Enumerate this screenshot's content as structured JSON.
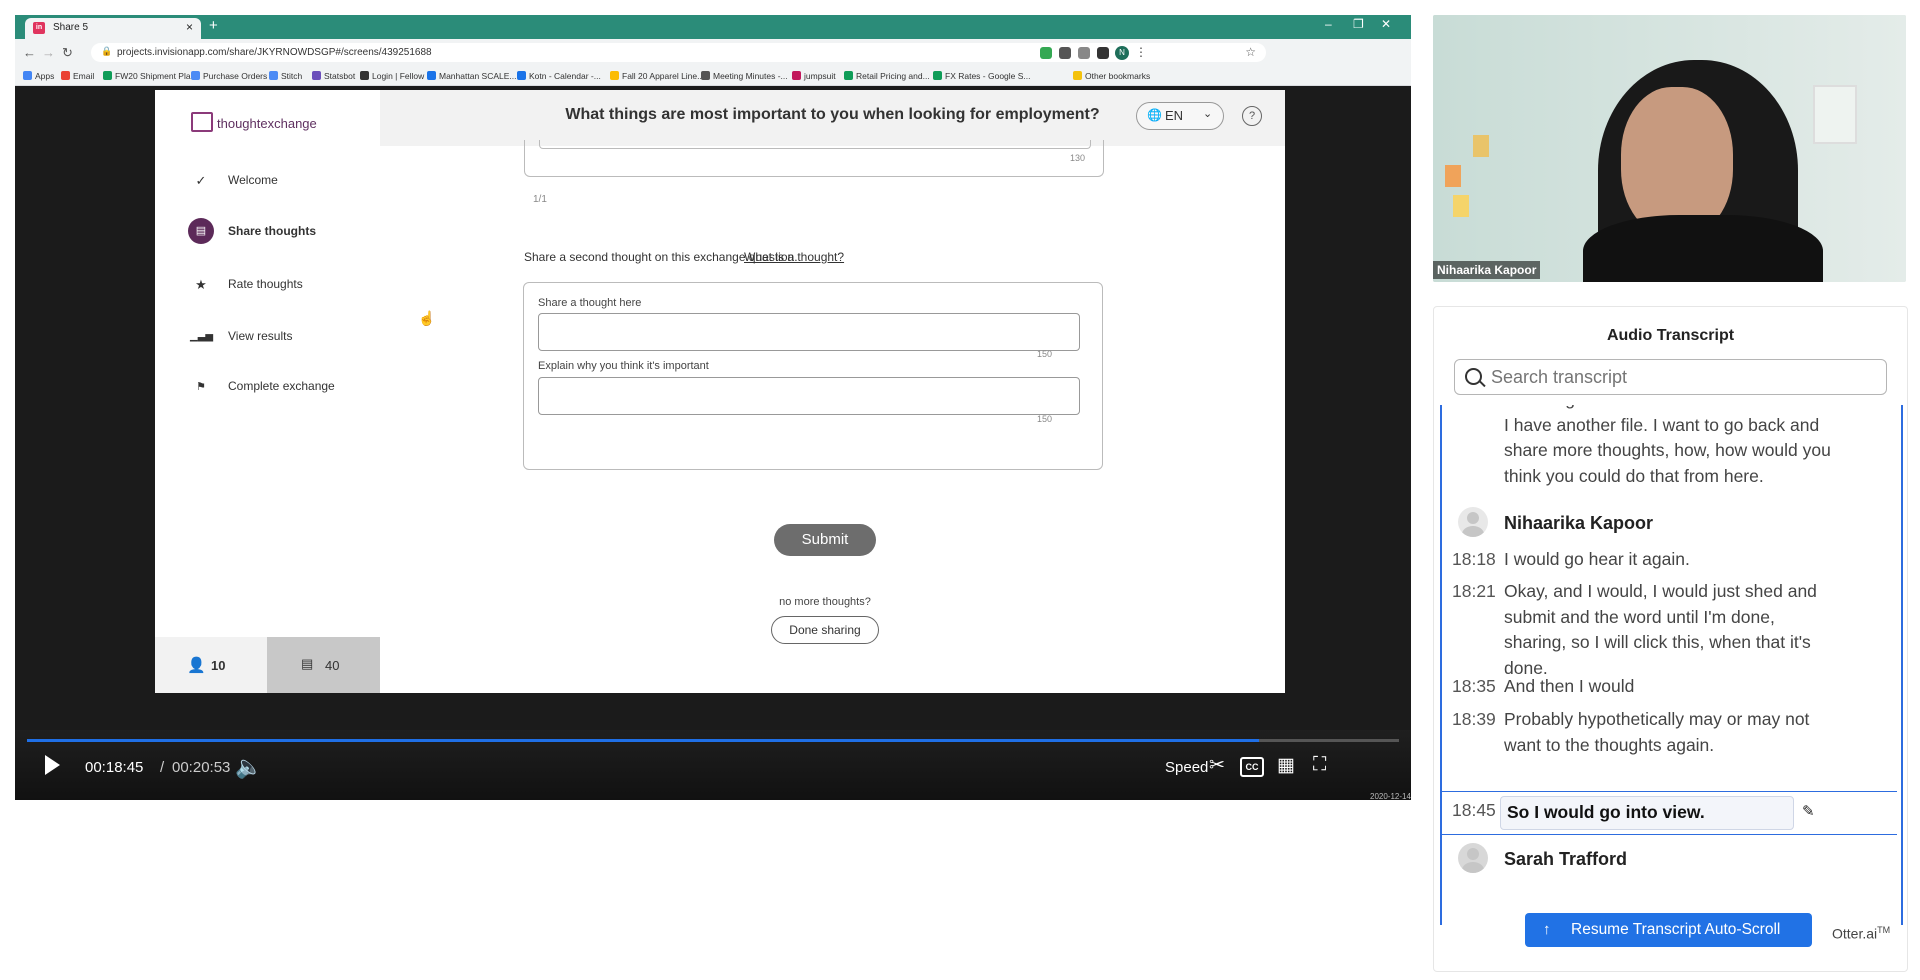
{
  "browser": {
    "tab_title": "Share 5",
    "url": "projects.invisionapp.com/share/JKYRNOWDSGP#/screens/439251688",
    "bookmarks": [
      "Apps",
      "Email",
      "FW20 Shipment Pla...",
      "Purchase Orders",
      "Stitch",
      "Statsbot",
      "Login | Fellow",
      "Manhattan SCALE...",
      "Kotn - Calendar -...",
      "Fall 20 Apparel Line...",
      "Meeting Minutes -...",
      "jumpsuit",
      "Retail Pricing and...",
      "FX Rates - Google S...",
      "Other bookmarks"
    ],
    "profile_initial": "N",
    "icons": [
      "back-arrow",
      "forward-arrow",
      "refresh",
      "lock",
      "star",
      "puzzle",
      "menu-dots"
    ]
  },
  "app": {
    "logo_text": "thoughtexchange",
    "question": "What things are most important to you when looking for employment?",
    "language": "EN",
    "help": "?",
    "steps": [
      {
        "label": "Welcome",
        "icon": "check"
      },
      {
        "label": "Share thoughts",
        "icon": "share"
      },
      {
        "label": "Rate thoughts",
        "icon": "star"
      },
      {
        "label": "View results",
        "icon": "bars"
      },
      {
        "label": "Complete exchange",
        "icon": "flag"
      }
    ],
    "participants_count": "10",
    "thoughts_count": "40",
    "top_card_count": "130",
    "pager": "1/1",
    "share_prompt": "Share a second thought on this exchange question.",
    "what_is_link": "What is a thought?",
    "field1_label": "Share a thought here",
    "field1_count": "150",
    "field2_label": "Explain why you think it's important",
    "field2_count": "150",
    "submit_label": "Submit",
    "no_more": "no more thoughts?",
    "done_label": "Done sharing"
  },
  "player": {
    "current_time": "00:18:45",
    "separator": "/",
    "total_time": "00:20:53",
    "progress_fraction": 0.898,
    "speed_label": "Speed",
    "cc_label": "CC",
    "date": "2020-12-14",
    "accent": "#1f6fe6"
  },
  "camera": {
    "participant_name": "Nihaarika Kapoor"
  },
  "transcript": {
    "title": "Audio Transcript",
    "search_placeholder": "Search transcript",
    "partial_top": "want to go back and re or share more like I have another file. I want to go back and share more thoughts, how, how would you think you could do that from here.",
    "speaker1": "Nihaarika Kapoor",
    "lines": [
      {
        "time": "18:18",
        "text": "I would go hear it again."
      },
      {
        "time": "18:21",
        "text": "Okay, and I would, I would just shed and submit and the word until I'm done, sharing, so I will click this, when that it's done."
      },
      {
        "time": "18:35",
        "text": "And then I would"
      },
      {
        "time": "18:39",
        "text": "Probably hypothetically may or may not want to the thoughts again."
      }
    ],
    "current": {
      "time": "18:45",
      "text": "So I would go into view."
    },
    "speaker2": "Sarah Trafford",
    "resume_label": "Resume Transcript Auto-Scroll",
    "brand": "Otter.ai",
    "brand_tm": "TM",
    "accent": "#2172e5"
  }
}
